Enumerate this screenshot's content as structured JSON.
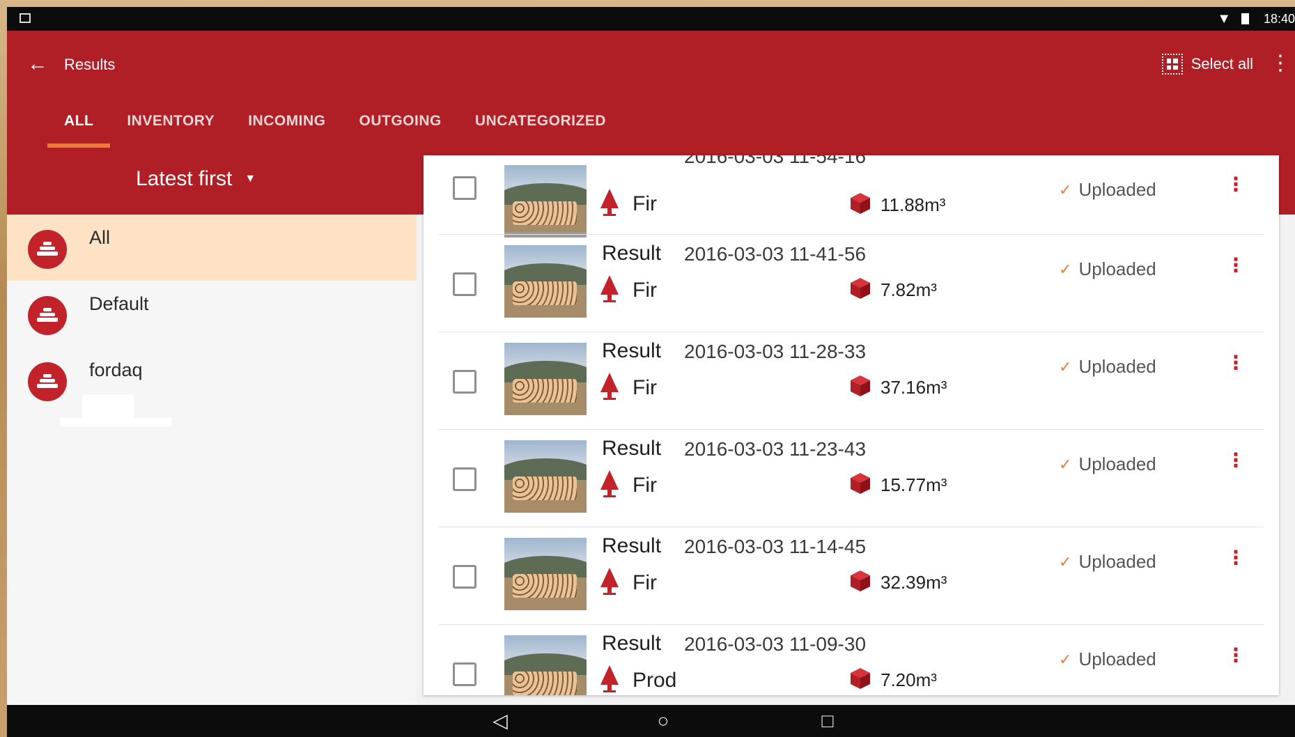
{
  "status_bar": {
    "time": "18:40"
  },
  "app_bar": {
    "title": "Results",
    "select_all_label": "Select all"
  },
  "tabs": [
    "ALL",
    "INVENTORY",
    "INCOMING",
    "OUTGOING",
    "UNCATEGORIZED"
  ],
  "sort": {
    "label": "Latest first"
  },
  "categories": [
    {
      "label": "All",
      "active": true
    },
    {
      "label": "Default",
      "active": false
    },
    {
      "label": "fordaq",
      "active": false
    }
  ],
  "results": [
    {
      "title": "",
      "date": "2016-03-03 11-54-16",
      "species": "Fir",
      "volume": "11.88m³",
      "status": "Uploaded"
    },
    {
      "title": "Result",
      "date": "2016-03-03 11-41-56",
      "species": "Fir",
      "volume": "7.82m³",
      "status": "Uploaded"
    },
    {
      "title": "Result",
      "date": "2016-03-03 11-28-33",
      "species": "Fir",
      "volume": "37.16m³",
      "status": "Uploaded"
    },
    {
      "title": "Result",
      "date": "2016-03-03 11-23-43",
      "species": "Fir",
      "volume": "15.77m³",
      "status": "Uploaded"
    },
    {
      "title": "Result",
      "date": "2016-03-03 11-14-45",
      "species": "Fir",
      "volume": "32.39m³",
      "status": "Uploaded"
    },
    {
      "title": "Result",
      "date": "2016-03-03 11-09-30",
      "species": "Prod",
      "volume": "7.20m³",
      "status": "Uploaded"
    }
  ],
  "colors": {
    "primary": "#b01e26",
    "accent": "#ec7a3a",
    "selected_row": "#fde2c6"
  },
  "icons": {
    "back": "arrow-left-icon",
    "select_all": "grid-select-icon",
    "overflow": "more-vert-icon",
    "category": "log-pile-icon",
    "species": "tree-icon",
    "volume": "cube-icon",
    "status": "check-icon"
  }
}
